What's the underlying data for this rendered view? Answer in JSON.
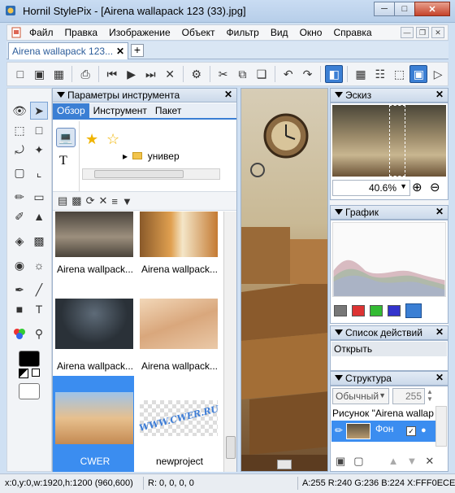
{
  "window": {
    "title": "Hornil StylePix - [Airena wallapack 123 (33).jpg]"
  },
  "menu": {
    "items": [
      "Файл",
      "Правка",
      "Изображение",
      "Объект",
      "Фильтр",
      "Вид",
      "Окно",
      "Справка"
    ]
  },
  "document_tab": {
    "label": "Airena wallapack 123..."
  },
  "tool_params": {
    "title": "Параметры инструмента",
    "tabs": [
      "Обзор",
      "Инструмент",
      "Пакет"
    ],
    "folder": "универ",
    "thumbnails": [
      {
        "caption": "Airena wallpack..."
      },
      {
        "caption": "Airena wallpack..."
      },
      {
        "caption": "Airena wallpack..."
      },
      {
        "caption": "Airena wallpack..."
      },
      {
        "caption": "CWER"
      },
      {
        "caption": "newproject"
      }
    ],
    "watermark_text": "WWW.CWER.RU"
  },
  "sketch": {
    "title": "Эскиз",
    "zoom": "40.6%"
  },
  "graph": {
    "title": "График"
  },
  "actions": {
    "title": "Список действий",
    "items": [
      "Открыть"
    ]
  },
  "structure": {
    "title": "Структура",
    "blend_mode": "Обычный",
    "opacity": "255",
    "group_label": "Рисунок \"Airena wallap",
    "layer_label": "Фон"
  },
  "status": {
    "coords": "x:0,y:0,w:1920,h:1200 (960,600)",
    "rect": "R: 0, 0, 0, 0",
    "color": "A:255 R:240 G:236 B:224 X:FFF0ECE"
  },
  "colors": {
    "accent": "#3b7fd4",
    "selected": "#3b8df0",
    "titlebar": "#c9dcf2"
  }
}
